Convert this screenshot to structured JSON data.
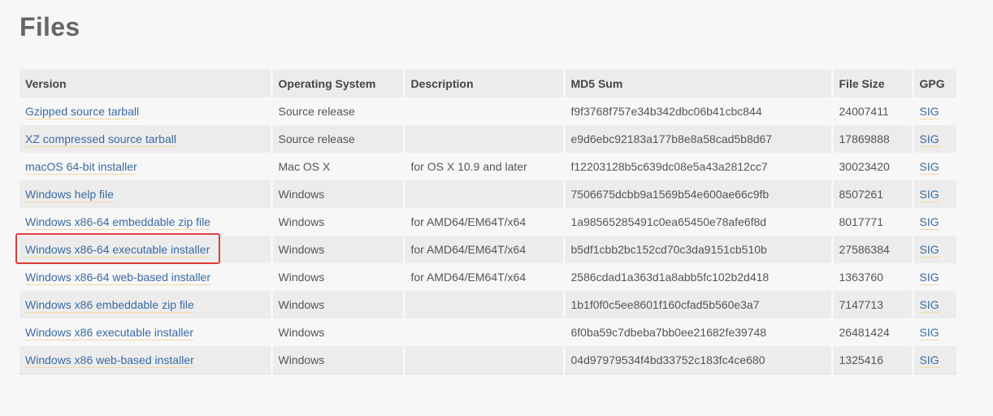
{
  "title": "Files",
  "highlight_color": "#e23a3a",
  "link_color": "#3b6ba0",
  "headers": {
    "version": "Version",
    "os": "Operating System",
    "description": "Description",
    "md5": "MD5 Sum",
    "size": "File Size",
    "gpg": "GPG"
  },
  "rows": [
    {
      "version": "Gzipped source tarball",
      "os": "Source release",
      "description": "",
      "md5": "f9f3768f757e34b342dbc06b41cbc844",
      "size": "24007411",
      "gpg": "SIG"
    },
    {
      "version": "XZ compressed source tarball",
      "os": "Source release",
      "description": "",
      "md5": "e9d6ebc92183a177b8e8a58cad5b8d67",
      "size": "17869888",
      "gpg": "SIG"
    },
    {
      "version": "macOS 64-bit installer",
      "os": "Mac OS X",
      "description": "for OS X 10.9 and later",
      "md5": "f12203128b5c639dc08e5a43a2812cc7",
      "size": "30023420",
      "gpg": "SIG"
    },
    {
      "version": "Windows help file",
      "os": "Windows",
      "description": "",
      "md5": "7506675dcbb9a1569b54e600ae66c9fb",
      "size": "8507261",
      "gpg": "SIG"
    },
    {
      "version": "Windows x86-64 embeddable zip file",
      "os": "Windows",
      "description": "for AMD64/EM64T/x64",
      "md5": "1a98565285491c0ea65450e78afe6f8d",
      "size": "8017771",
      "gpg": "SIG"
    },
    {
      "version": "Windows x86-64 executable installer",
      "os": "Windows",
      "description": "for AMD64/EM64T/x64",
      "md5": "b5df1cbb2bc152cd70c3da9151cb510b",
      "size": "27586384",
      "gpg": "SIG"
    },
    {
      "version": "Windows x86-64 web-based installer",
      "os": "Windows",
      "description": "for AMD64/EM64T/x64",
      "md5": "2586cdad1a363d1a8abb5fc102b2d418",
      "size": "1363760",
      "gpg": "SIG"
    },
    {
      "version": "Windows x86 embeddable zip file",
      "os": "Windows",
      "description": "",
      "md5": "1b1f0f0c5ee8601f160cfad5b560e3a7",
      "size": "7147713",
      "gpg": "SIG"
    },
    {
      "version": "Windows x86 executable installer",
      "os": "Windows",
      "description": "",
      "md5": "6f0ba59c7dbeba7bb0ee21682fe39748",
      "size": "26481424",
      "gpg": "SIG"
    },
    {
      "version": "Windows x86 web-based installer",
      "os": "Windows",
      "description": "",
      "md5": "04d97979534f4bd33752c183fc4ce680",
      "size": "1325416",
      "gpg": "SIG"
    }
  ]
}
